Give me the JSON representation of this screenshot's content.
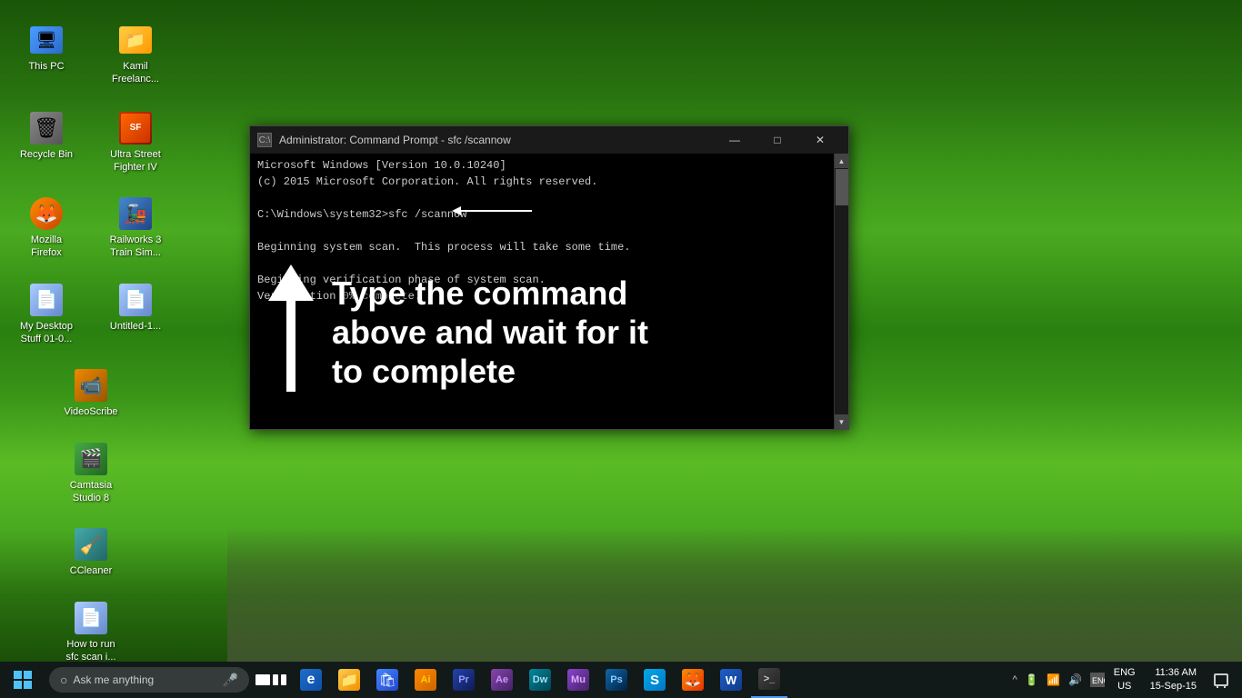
{
  "desktop": {
    "background": "#1a4a0a"
  },
  "icons": [
    {
      "id": "this-pc",
      "label": "This PC",
      "color": "icon-pc",
      "symbol": "🖥"
    },
    {
      "id": "kamil-freelanc",
      "label": "Kamil\nFreelanc...",
      "color": "icon-folder",
      "symbol": "📁"
    },
    {
      "id": "recycle-bin",
      "label": "Recycle Bin",
      "color": "icon-recycle",
      "symbol": "🗑"
    },
    {
      "id": "street-fighter",
      "label": "Ultra Street\nFighter IV",
      "color": "icon-generic",
      "symbol": "🎮"
    },
    {
      "id": "mozilla-firefox",
      "label": "Mozilla\nFirefox",
      "color": "icon-firefox",
      "symbol": "🦊"
    },
    {
      "id": "railworks",
      "label": "Railworks 3\nTrain Sim...",
      "color": "icon-blue",
      "symbol": "🚂"
    },
    {
      "id": "my-desktop",
      "label": "My Desktop\nStuff 01-0...",
      "color": "icon-doc",
      "symbol": "📄"
    },
    {
      "id": "untitled",
      "label": "Untitled-1...",
      "color": "icon-doc",
      "symbol": "📄"
    },
    {
      "id": "videoscribe",
      "label": "VideoScribe",
      "color": "icon-orange",
      "symbol": "📹"
    },
    {
      "id": "camtasia",
      "label": "Camtasia\nStudio 8",
      "color": "icon-green",
      "symbol": "🎬"
    },
    {
      "id": "ccleaner",
      "label": "CCleaner",
      "color": "icon-teal",
      "symbol": "🧹"
    },
    {
      "id": "how-to-run",
      "label": "How to run\nsfc scan i...",
      "color": "icon-doc",
      "symbol": "📄"
    }
  ],
  "cmd_window": {
    "title": "Administrator: Command Prompt - sfc  /scannow",
    "lines": [
      "Microsoft Windows [Version 10.0.10240]",
      "(c) 2015 Microsoft Corporation. All rights reserved.",
      "",
      "C:\\Windows\\system32>sfc /scannow",
      "",
      "Beginning system scan.  This process will take some time.",
      "",
      "Beginning verification phase of system scan.",
      "Verification 0% complete."
    ],
    "annotation": "Type the command\nabove and wait for it\nto complete"
  },
  "taskbar": {
    "search_placeholder": "Ask me anything",
    "apps": [
      {
        "id": "edge",
        "label": "e",
        "color": "app-edge"
      },
      {
        "id": "explorer",
        "label": "📁",
        "color": "app-explorer"
      },
      {
        "id": "store",
        "label": "🛍",
        "color": "app-store"
      },
      {
        "id": "illustrator",
        "label": "Ai",
        "color": "app-ai"
      },
      {
        "id": "premiere",
        "label": "Pr",
        "color": "app-pr"
      },
      {
        "id": "after-effects",
        "label": "Ae",
        "color": "app-ae"
      },
      {
        "id": "dreamweaver",
        "label": "Dw",
        "color": "app-dw"
      },
      {
        "id": "muse",
        "label": "Mu",
        "color": "app-mu"
      },
      {
        "id": "photoshop",
        "label": "Ps",
        "color": "app-ps"
      },
      {
        "id": "skype",
        "label": "S",
        "color": "app-skype"
      },
      {
        "id": "firefox",
        "label": "🦊",
        "color": "app-ff"
      },
      {
        "id": "word",
        "label": "W",
        "color": "app-word"
      },
      {
        "id": "powershell",
        "label": ">_",
        "color": "app-ps2"
      }
    ],
    "time": "11:36 AM",
    "date": "15-Sep-15",
    "lang": "ENG",
    "region": "US"
  }
}
